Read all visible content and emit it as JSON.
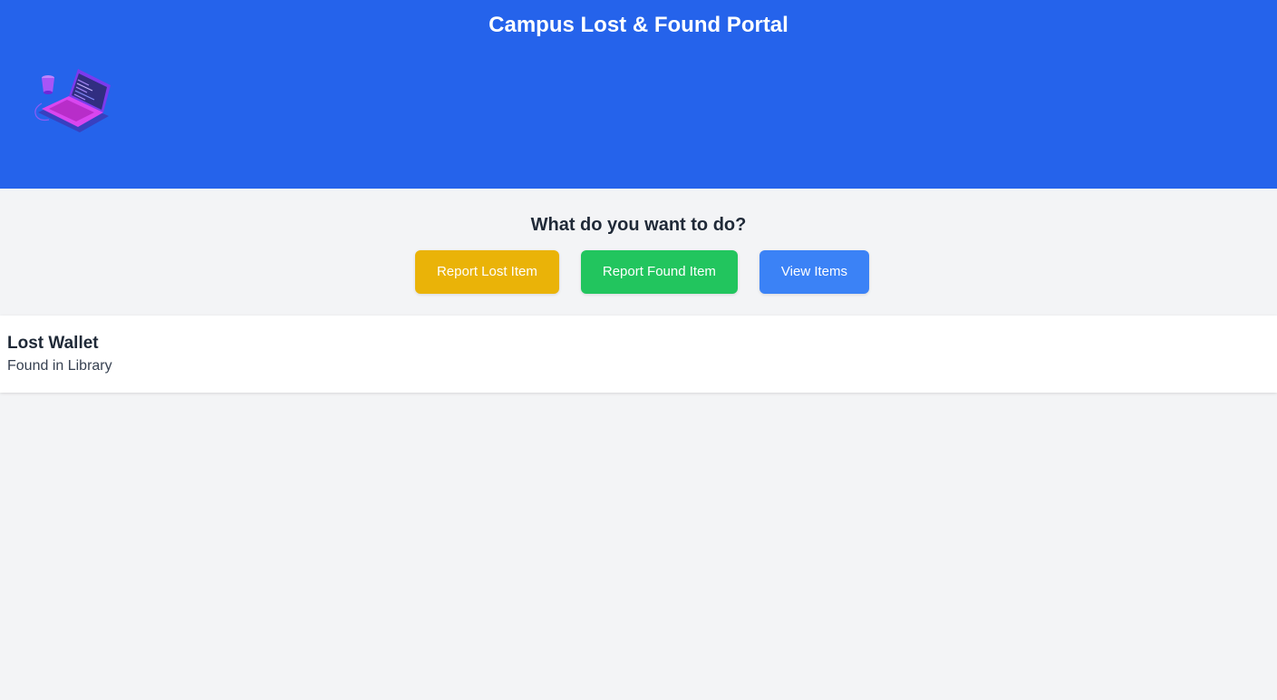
{
  "header": {
    "title": "Campus Lost & Found Portal",
    "logo_icon": "laptop-illustration-icon"
  },
  "actions": {
    "heading": "What do you want to do?",
    "buttons": [
      {
        "label": "Report Lost Item",
        "color": "#eab308"
      },
      {
        "label": "Report Found Item",
        "color": "#22c55e"
      },
      {
        "label": "View Items",
        "color": "#3b82f6"
      }
    ]
  },
  "items": [
    {
      "title": "Lost Wallet",
      "description": "Found in Library"
    }
  ],
  "colors": {
    "header_bg": "#2563eb",
    "page_bg": "#f3f4f6",
    "card_bg": "#ffffff"
  }
}
